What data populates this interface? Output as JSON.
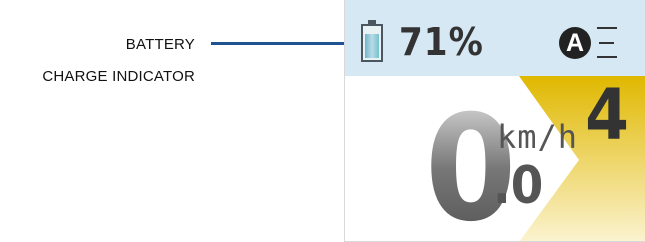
{
  "callout": {
    "line1": "BATTERY",
    "line2": "CHARGE INDICATOR"
  },
  "status_bar": {
    "battery_percent_text": "71%",
    "battery_level": 0.71,
    "mode_letter": "A",
    "menu_icon": "menu-lines-icon",
    "battery_icon": "battery-icon"
  },
  "assist": {
    "level": "4"
  },
  "speed": {
    "integer": "0",
    "decimal": ".0",
    "unit": "km/h"
  },
  "colors": {
    "status_bar_bg": "#d6e8f3",
    "accent_yellow": "#e0b800",
    "leader_line": "#1f5291"
  }
}
